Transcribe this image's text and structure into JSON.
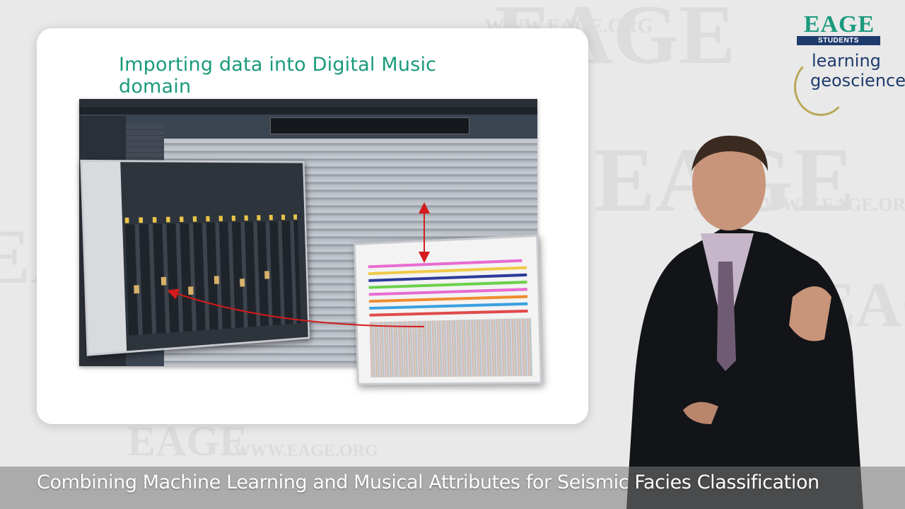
{
  "slide": {
    "title": "Importing data into Digital Music domain"
  },
  "logo": {
    "brand": "EAGE",
    "sub_brand": "STUDENTS",
    "tagline_line1": "learning",
    "tagline_line2": "geoscience"
  },
  "watermark": {
    "brand": "EAGE",
    "url": "WWW.EAGE.ORG"
  },
  "caption": {
    "text": "Combining Machine Learning and Musical Attributes for Seismic Facies Classification"
  },
  "colors": {
    "title_green": "#1a9a7c",
    "logo_navy": "#1f3b6e",
    "annotation_red": "#d31b1b",
    "caption_bg": "#787878"
  }
}
